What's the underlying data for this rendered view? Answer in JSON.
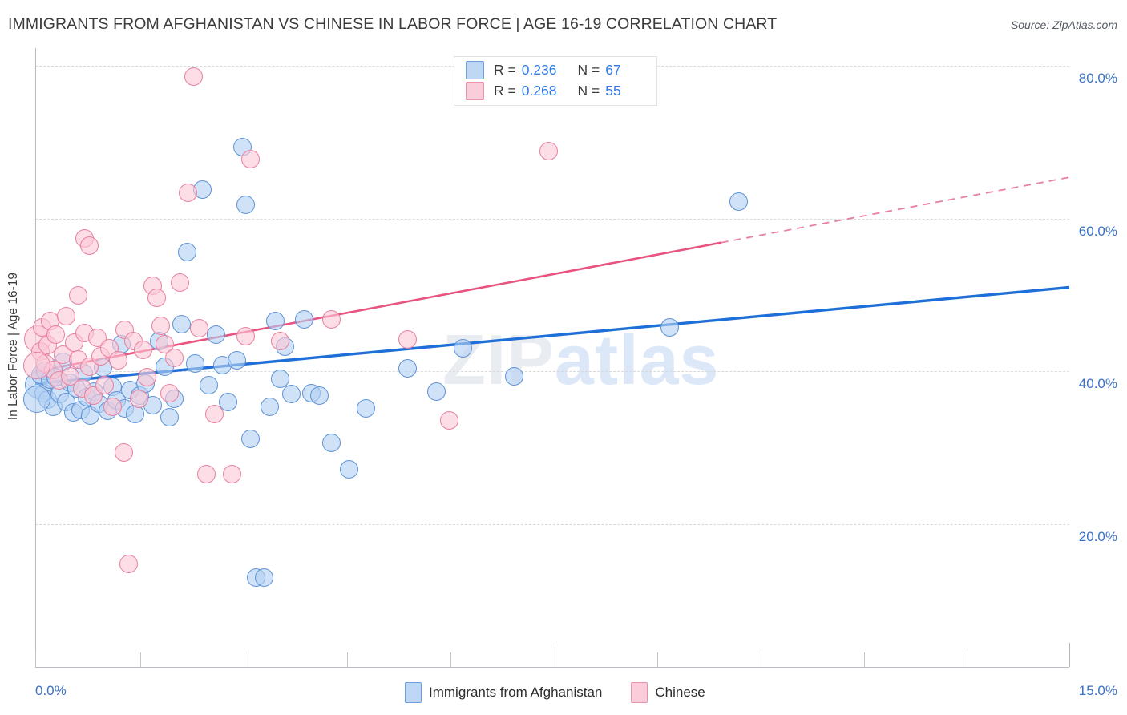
{
  "header": {
    "title": "IMMIGRANTS FROM AFGHANISTAN VS CHINESE IN LABOR FORCE | AGE 16-19 CORRELATION CHART",
    "source": "Source: ZipAtlas.com"
  },
  "watermark": {
    "part1": "ZIP",
    "part2": "atlas"
  },
  "stats": {
    "blue": {
      "r_label": "R =",
      "r_value": "0.236",
      "n_label": "N =",
      "n_value": "67"
    },
    "pink": {
      "r_label": "R =",
      "r_value": "0.268",
      "n_label": "N =",
      "n_value": "55"
    }
  },
  "legend": {
    "blue_label": "Immigrants from Afghanistan",
    "pink_label": "Chinese"
  },
  "axis": {
    "y_title": "In Labor Force | Age 16-19",
    "x_min_label": "0.0%",
    "x_max_label": "15.0%",
    "y_ticks": [
      "80.0%",
      "60.0%",
      "40.0%",
      "20.0%"
    ]
  },
  "colors": {
    "blue_line": "#1f6fd8",
    "pink_line": "#e8537f",
    "blue_fill": "#b3d1f2",
    "pink_fill": "#fbc8d7",
    "tick_text": "#3b72c4",
    "title_text": "#3c3c3c"
  },
  "chart_data": {
    "type": "scatter",
    "title": "IMMIGRANTS FROM AFGHANISTAN VS CHINESE IN LABOR FORCE | AGE 16-19 CORRELATION CHART",
    "xlabel": "",
    "ylabel": "In Labor Force | Age 16-19",
    "xlim": [
      0.0,
      15.0
    ],
    "ylim": [
      8.0,
      85.0
    ],
    "x_unit": "%",
    "y_unit": "%",
    "grid": true,
    "legend_position": "bottom-center",
    "y_ticks": [
      20.0,
      40.0,
      60.0,
      80.0
    ],
    "series": [
      {
        "name": "Immigrants from Afghanistan",
        "color": "#b3d1f2",
        "r": 0.236,
        "n": 67,
        "trendline": {
          "style": "solid",
          "x_start": 0.0,
          "y_start": 38.4,
          "x_end": 15.0,
          "y_end": 51.0
        },
        "points": [
          [
            0.05,
            38.2
          ],
          [
            0.08,
            39.6
          ],
          [
            0.12,
            37.2
          ],
          [
            0.15,
            40.1
          ],
          [
            0.18,
            36.3
          ],
          [
            0.22,
            38.9
          ],
          [
            0.26,
            35.4
          ],
          [
            0.3,
            39.2
          ],
          [
            0.35,
            37.0
          ],
          [
            0.4,
            41.2
          ],
          [
            0.45,
            36.0
          ],
          [
            0.5,
            38.5
          ],
          [
            0.55,
            34.6
          ],
          [
            0.6,
            37.8
          ],
          [
            0.66,
            35.0
          ],
          [
            0.7,
            39.8
          ],
          [
            0.75,
            36.6
          ],
          [
            0.8,
            34.2
          ],
          [
            0.86,
            37.4
          ],
          [
            0.92,
            35.8
          ],
          [
            0.98,
            40.5
          ],
          [
            1.05,
            34.8
          ],
          [
            1.12,
            38.0
          ],
          [
            1.18,
            36.2
          ],
          [
            1.25,
            43.6
          ],
          [
            1.3,
            35.2
          ],
          [
            1.38,
            37.6
          ],
          [
            1.45,
            34.4
          ],
          [
            1.52,
            36.8
          ],
          [
            1.6,
            38.4
          ],
          [
            1.7,
            35.6
          ],
          [
            1.8,
            44.0
          ],
          [
            1.88,
            40.6
          ],
          [
            1.95,
            34.0
          ],
          [
            2.02,
            36.4
          ],
          [
            2.12,
            46.2
          ],
          [
            2.2,
            55.6
          ],
          [
            2.32,
            41.0
          ],
          [
            2.42,
            63.8
          ],
          [
            2.52,
            38.2
          ],
          [
            2.62,
            44.8
          ],
          [
            2.72,
            40.8
          ],
          [
            2.8,
            36.0
          ],
          [
            2.92,
            41.4
          ],
          [
            3.0,
            69.4
          ],
          [
            3.05,
            61.8
          ],
          [
            3.12,
            31.2
          ],
          [
            3.2,
            13.0
          ],
          [
            3.32,
            13.0
          ],
          [
            3.4,
            35.4
          ],
          [
            3.48,
            46.6
          ],
          [
            3.55,
            39.0
          ],
          [
            3.62,
            43.2
          ],
          [
            3.72,
            37.0
          ],
          [
            3.9,
            46.8
          ],
          [
            4.0,
            37.2
          ],
          [
            4.12,
            36.8
          ],
          [
            4.3,
            30.6
          ],
          [
            4.55,
            27.2
          ],
          [
            4.8,
            35.2
          ],
          [
            5.4,
            40.4
          ],
          [
            5.82,
            37.4
          ],
          [
            6.2,
            43.0
          ],
          [
            6.95,
            39.4
          ],
          [
            9.2,
            45.8
          ],
          [
            10.2,
            62.2
          ],
          [
            0.02,
            36.4
          ]
        ]
      },
      {
        "name": "Chinese",
        "color": "#fbc8d7",
        "r": 0.268,
        "n": 55,
        "trendline": {
          "style": "solid-then-dashed",
          "x_start": 0.0,
          "y_start": 40.0,
          "x_end": 15.0,
          "y_end": 65.4,
          "dash_from_x": 9.95
        },
        "points": [
          [
            0.04,
            44.2
          ],
          [
            0.07,
            42.6
          ],
          [
            0.1,
            45.8
          ],
          [
            0.14,
            41.0
          ],
          [
            0.18,
            43.4
          ],
          [
            0.22,
            46.6
          ],
          [
            0.26,
            40.2
          ],
          [
            0.3,
            44.8
          ],
          [
            0.34,
            38.8
          ],
          [
            0.4,
            42.2
          ],
          [
            0.45,
            47.2
          ],
          [
            0.5,
            39.4
          ],
          [
            0.56,
            43.8
          ],
          [
            0.62,
            41.6
          ],
          [
            0.68,
            37.8
          ],
          [
            0.72,
            45.0
          ],
          [
            0.78,
            40.6
          ],
          [
            0.84,
            36.8
          ],
          [
            0.9,
            44.4
          ],
          [
            0.62,
            50.0
          ],
          [
            0.72,
            57.4
          ],
          [
            0.78,
            56.4
          ],
          [
            0.95,
            42.0
          ],
          [
            1.0,
            38.2
          ],
          [
            1.08,
            43.0
          ],
          [
            1.12,
            35.4
          ],
          [
            1.2,
            41.4
          ],
          [
            1.28,
            29.4
          ],
          [
            1.3,
            45.4
          ],
          [
            1.35,
            14.8
          ],
          [
            1.42,
            44.0
          ],
          [
            1.5,
            36.4
          ],
          [
            1.56,
            42.8
          ],
          [
            1.62,
            39.2
          ],
          [
            1.7,
            51.2
          ],
          [
            1.76,
            49.6
          ],
          [
            1.82,
            46.0
          ],
          [
            1.88,
            43.6
          ],
          [
            1.95,
            37.2
          ],
          [
            2.02,
            41.8
          ],
          [
            2.1,
            51.6
          ],
          [
            2.22,
            63.4
          ],
          [
            2.3,
            78.6
          ],
          [
            2.38,
            45.6
          ],
          [
            2.48,
            26.6
          ],
          [
            2.6,
            34.4
          ],
          [
            2.85,
            26.6
          ],
          [
            3.05,
            44.6
          ],
          [
            3.12,
            67.8
          ],
          [
            3.55,
            44.0
          ],
          [
            4.3,
            46.8
          ],
          [
            5.4,
            44.2
          ],
          [
            6.0,
            33.6
          ],
          [
            7.45,
            68.8
          ],
          [
            0.02,
            40.8
          ]
        ]
      }
    ]
  }
}
